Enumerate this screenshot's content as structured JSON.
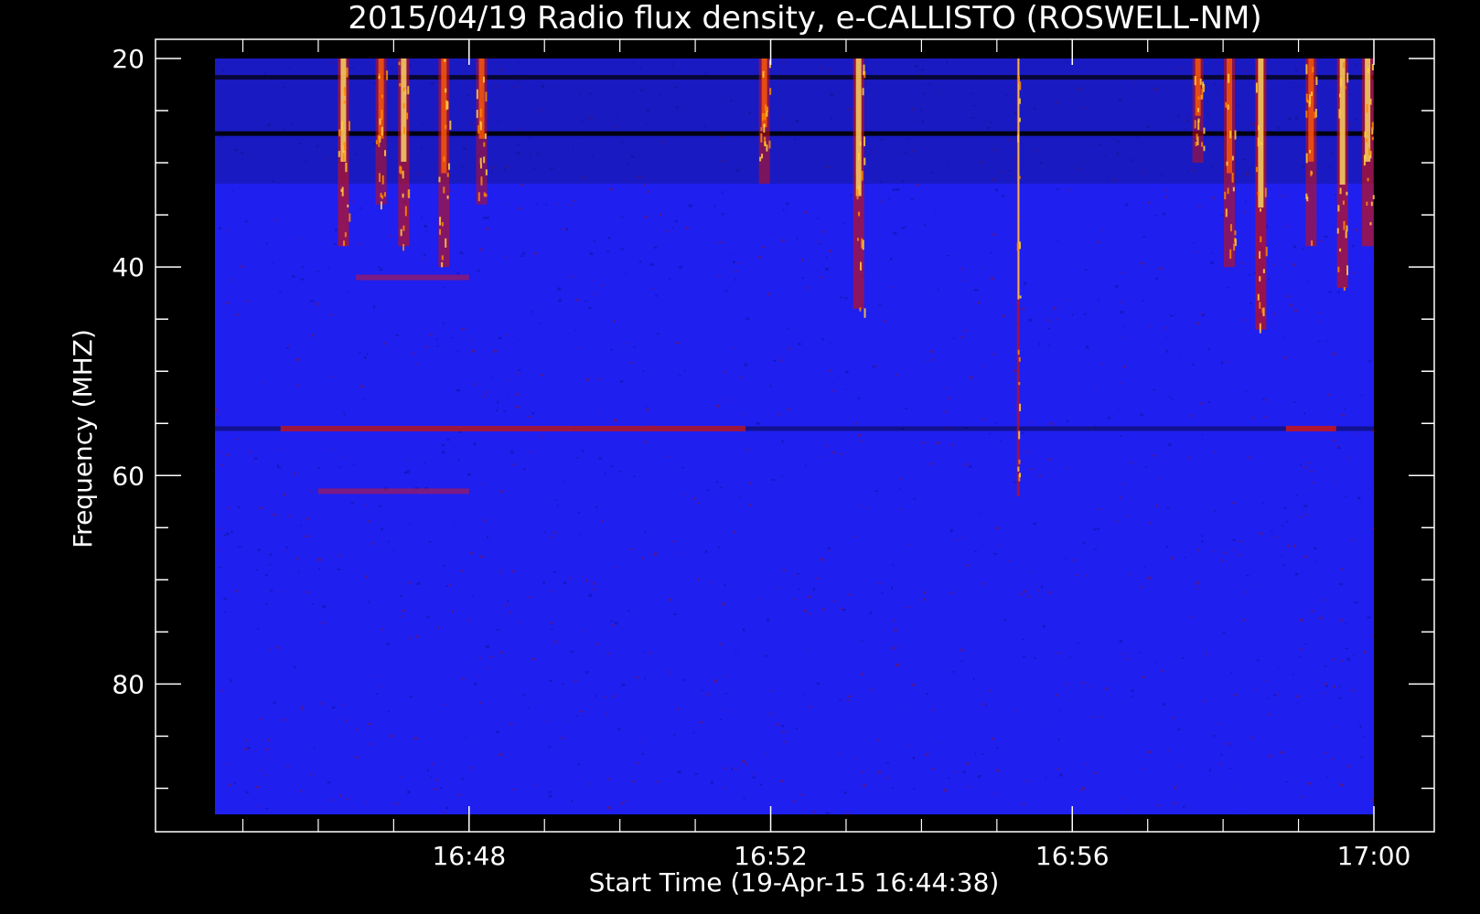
{
  "chart_data": {
    "type": "heatmap",
    "title": "2015/04/19  Radio flux density, e-CALLISTO (ROSWELL-NM)",
    "xlabel": "Start Time (19-Apr-15 16:44:38)",
    "ylabel": "Frequency (MHZ)",
    "x_unit": "minutes of day",
    "xlim": [
      1004.63,
      1020.0
    ],
    "ylim": [
      92.5,
      20
    ],
    "x_ticks": [
      {
        "value": 1008,
        "label": "16:48"
      },
      {
        "value": 1012,
        "label": "16:52"
      },
      {
        "value": 1016,
        "label": "16:56"
      },
      {
        "value": 1020,
        "label": "17:00"
      }
    ],
    "y_ticks": [
      {
        "value": 20,
        "label": "20"
      },
      {
        "value": 40,
        "label": "40"
      },
      {
        "value": 60,
        "label": "60"
      },
      {
        "value": 80,
        "label": "80"
      }
    ],
    "colormap": [
      "#000000",
      "#0a0a9a",
      "#1f1ff0",
      "#c81010",
      "#ff5a00",
      "#ffe060"
    ],
    "background_color": "#1f1ff0",
    "burst_columns": [
      {
        "time": "16:46:20",
        "freq_range": [
          20,
          38
        ],
        "intensity": 0.9
      },
      {
        "time": "16:46:50",
        "freq_range": [
          20,
          34
        ],
        "intensity": 0.75
      },
      {
        "time": "16:47:08",
        "freq_range": [
          20,
          38
        ],
        "intensity": 0.85
      },
      {
        "time": "16:47:40",
        "freq_range": [
          20,
          40
        ],
        "intensity": 0.8
      },
      {
        "time": "16:48:10",
        "freq_range": [
          20,
          34
        ],
        "intensity": 0.7
      },
      {
        "time": "16:51:55",
        "freq_range": [
          20,
          32
        ],
        "intensity": 0.75
      },
      {
        "time": "16:53:10",
        "freq_range": [
          20,
          44
        ],
        "intensity": 0.85
      },
      {
        "time": "16:55:17",
        "freq_range": [
          20,
          62
        ],
        "intensity": 1.0
      },
      {
        "time": "16:57:40",
        "freq_range": [
          20,
          30
        ],
        "intensity": 0.7
      },
      {
        "time": "16:58:05",
        "freq_range": [
          20,
          40
        ],
        "intensity": 0.8
      },
      {
        "time": "16:58:30",
        "freq_range": [
          20,
          46
        ],
        "intensity": 0.95
      },
      {
        "time": "16:59:10",
        "freq_range": [
          20,
          38
        ],
        "intensity": 0.8
      },
      {
        "time": "16:59:35",
        "freq_range": [
          20,
          42
        ],
        "intensity": 0.9
      },
      {
        "time": "16:59:55",
        "freq_range": [
          20,
          38
        ],
        "intensity": 0.9
      }
    ],
    "dark_bands": [
      {
        "freq": 21.8,
        "intensity": 0.7
      },
      {
        "freq": 27.2,
        "intensity": 0.9
      },
      {
        "freq": 55.5,
        "intensity": 0.4
      }
    ],
    "emission_lines": [
      {
        "freq": 55.5,
        "time_range": [
          "16:45:30",
          "16:51:40"
        ],
        "intensity": 0.7
      },
      {
        "freq": 55.5,
        "time_range": [
          "16:58:50",
          "16:59:30"
        ],
        "intensity": 0.8
      },
      {
        "freq": 61.5,
        "time_range": [
          "16:46:00",
          "16:48:00"
        ],
        "intensity": 0.5
      },
      {
        "freq": 41,
        "time_range": [
          "16:46:30",
          "16:48:00"
        ],
        "intensity": 0.5
      }
    ]
  }
}
